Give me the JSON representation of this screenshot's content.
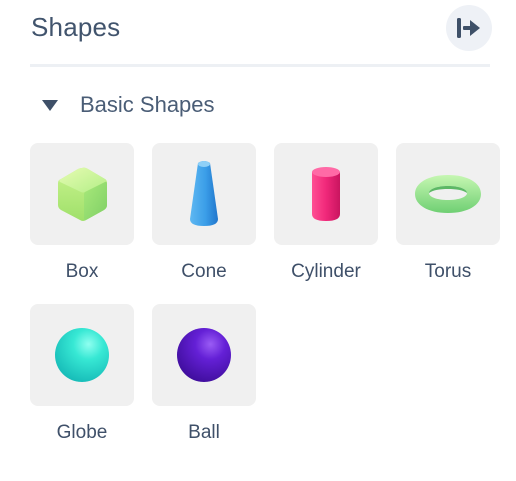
{
  "panel": {
    "title": "Shapes",
    "collapse_icon": "collapse-right-icon"
  },
  "section": {
    "label": "Basic Shapes",
    "icon": "caret-down-icon"
  },
  "shapes": [
    {
      "label": "Box",
      "icon": "box-icon",
      "color": "#a6ec7c"
    },
    {
      "label": "Cone",
      "icon": "cone-icon",
      "color": "#3ea2ea"
    },
    {
      "label": "Cylinder",
      "icon": "cylinder-icon",
      "color": "#f0287a"
    },
    {
      "label": "Torus",
      "icon": "torus-icon",
      "color": "#9de88e"
    },
    {
      "label": "Globe",
      "icon": "globe-icon",
      "color": "#2fe3cf"
    },
    {
      "label": "Ball",
      "icon": "ball-icon",
      "color": "#5a14c8"
    }
  ]
}
